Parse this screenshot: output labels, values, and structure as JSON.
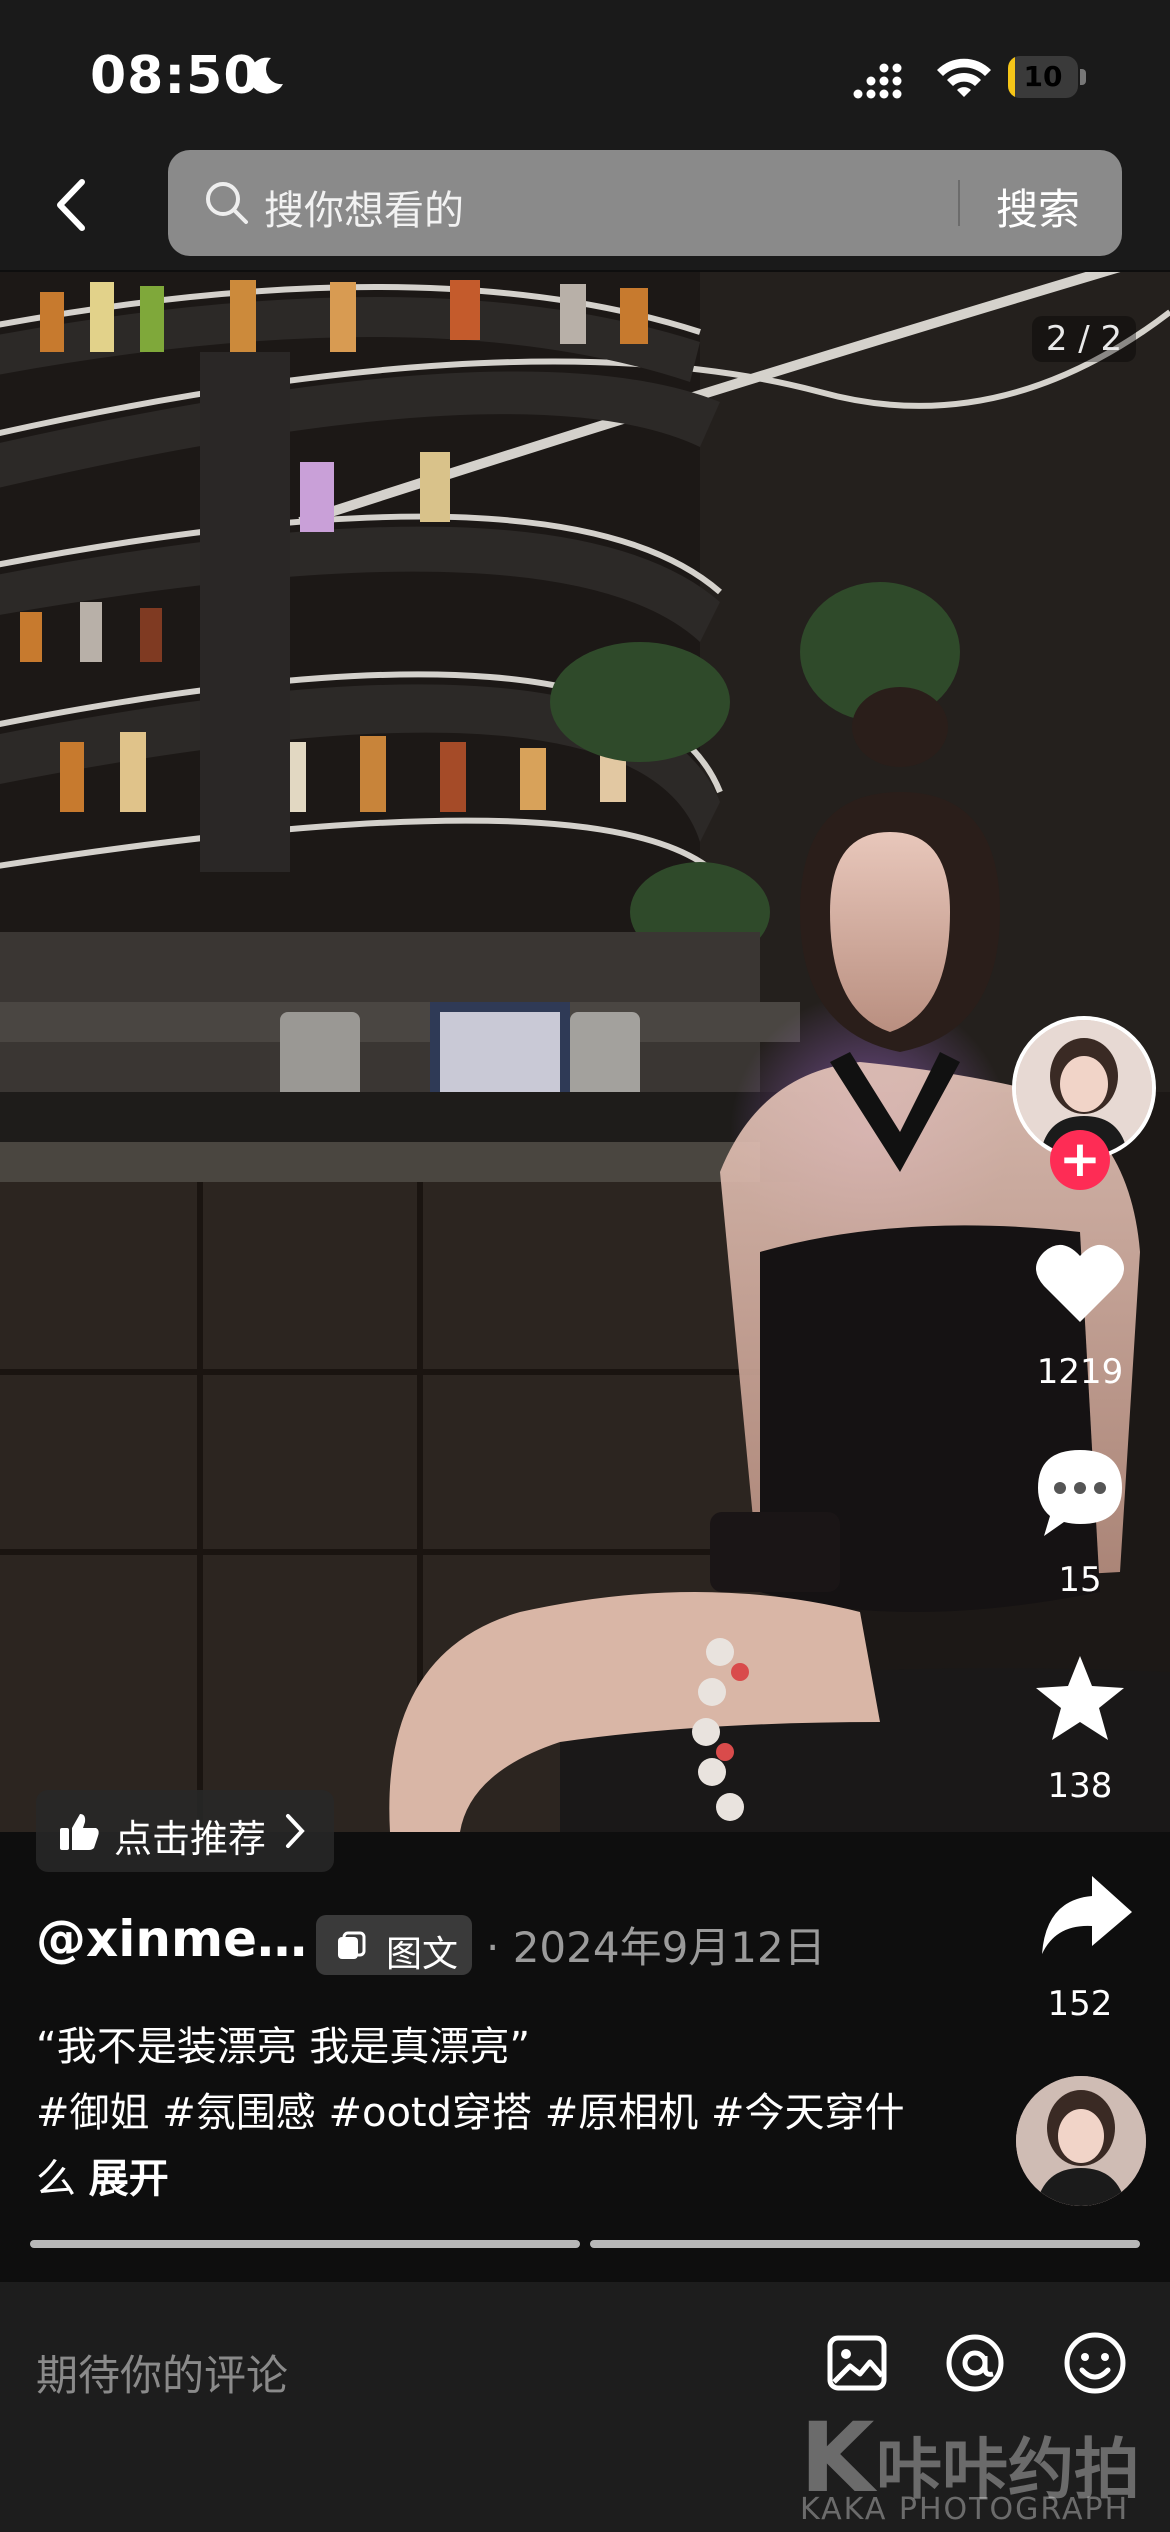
{
  "status_bar": {
    "time": "08:50",
    "battery_level": "10",
    "battery_fraction": 0.1
  },
  "search": {
    "placeholder": "搜你想看的",
    "button_label": "搜索"
  },
  "post": {
    "page_indicator": "2 / 2",
    "likes": "1219",
    "comments": "15",
    "favorites": "138",
    "shares": "152",
    "recommend_label": "点击推荐",
    "username": "@xinme…",
    "type_label": "图文",
    "date": "· 2024年9月12日",
    "caption": "“我不是装漂亮 我是真漂亮”",
    "hashtags": "#御姐 #氛围感 #ootd穿搭 #原相机 #今天穿什么",
    "expand_label": "展开"
  },
  "comment_bar": {
    "placeholder": "期待你的评论"
  },
  "watermark": {
    "logo_letter": "K",
    "cn": "咔咔约拍",
    "en": "KAKA PHOTOGRAPH"
  },
  "colors": {
    "accent": "#fe2c55",
    "battery": "#f5c518"
  },
  "icons": [
    "moon-icon",
    "signal-icon",
    "wifi-icon",
    "battery-icon",
    "back-icon",
    "search-icon",
    "heart-icon",
    "comment-icon",
    "star-icon",
    "share-icon",
    "thumbs-up-icon",
    "chevron-right-icon",
    "image-icon",
    "at-icon",
    "emoji-icon"
  ]
}
